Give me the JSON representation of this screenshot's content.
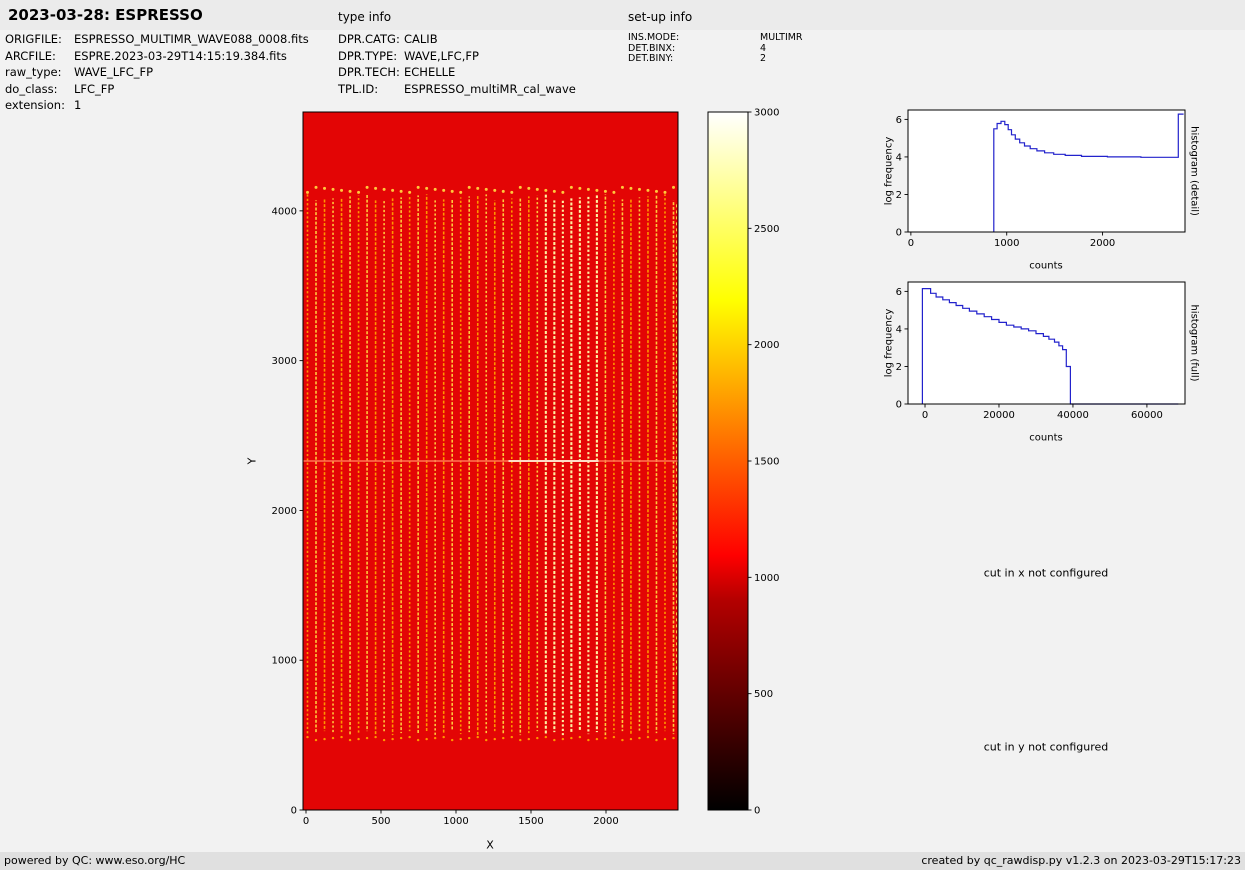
{
  "header": {
    "title": "2023-03-28: ESPRESSO",
    "type_info_label": "type info",
    "setup_info_label": "set-up info"
  },
  "file_info": {
    "rows": [
      {
        "label": "ORIGFILE:",
        "value": "ESPRESSO_MULTIMR_WAVE088_0008.fits"
      },
      {
        "label": "ARCFILE:",
        "value": "ESPRE.2023-03-29T14:15:19.384.fits"
      },
      {
        "label": "raw_type:",
        "value": "WAVE_LFC_FP"
      },
      {
        "label": "do_class:",
        "value": "LFC_FP"
      },
      {
        "label": "extension:",
        "value": "1"
      }
    ]
  },
  "type_info": {
    "rows": [
      {
        "label": "DPR.CATG:",
        "value": "CALIB"
      },
      {
        "label": "DPR.TYPE:",
        "value": "WAVE,LFC,FP"
      },
      {
        "label": "DPR.TECH:",
        "value": "ECHELLE"
      },
      {
        "label": "TPL.ID:",
        "value": "ESPRESSO_multiMR_cal_wave"
      }
    ]
  },
  "setup_info": {
    "rows": [
      {
        "label": "INS.MODE:",
        "value": "MULTIMR"
      },
      {
        "label": "DET.BINX:",
        "value": "4"
      },
      {
        "label": "DET.BINY:",
        "value": "2"
      }
    ]
  },
  "annotations": {
    "cut_x": "cut in x not configured",
    "cut_y": "cut in y not configured"
  },
  "footer": {
    "left": "powered by QC: www.eso.org/HC",
    "right": "created by qc_rawdisp.py v1.2.3 on 2023-03-29T15:17:23"
  },
  "chart_data": [
    {
      "id": "raw_frame",
      "type": "heatmap",
      "description": "ESPRESSO raw echelle calibration frame (WAVE,LFC,FP): dense vertical dashed LFC/FP emission stripes on uniform red background (~1000 counts), bad row near y=2330, brighter band near x=1550-1950, stripe region y=500-4110",
      "xlabel": "X",
      "ylabel": "Y",
      "xlim": [
        -20,
        2480
      ],
      "ylim": [
        0,
        4660
      ],
      "xticks": [
        0,
        500,
        1000,
        1500,
        2000
      ],
      "yticks": [
        0,
        1000,
        2000,
        3000,
        4000
      ],
      "colormap": "hot",
      "colormap_stops": [
        [
          0,
          "#000000"
        ],
        [
          0.1,
          "#3a0000"
        ],
        [
          0.2,
          "#760000"
        ],
        [
          0.3,
          "#b30000"
        ],
        [
          0.365,
          "#ff0000"
        ],
        [
          0.5,
          "#ff5e00"
        ],
        [
          0.6,
          "#ffa400"
        ],
        [
          0.73,
          "#ffff00"
        ],
        [
          0.85,
          "#ffff71"
        ],
        [
          1,
          "#ffffff"
        ]
      ],
      "colorbar": {
        "min": 0,
        "max": 3000,
        "ticks": [
          0,
          500,
          1000,
          1500,
          2000,
          2500,
          3000
        ]
      },
      "colors": {
        "background": "#e30505",
        "stripe_a": "#ffc83c",
        "stripe_b": "#ff9500",
        "stripe_bright": "#fff0a0",
        "bad_row": "#ff7755",
        "bad_row_bright": "#ffddc8"
      },
      "features": {
        "stripe_count": 44,
        "stripe_region_y": [
          500,
          4110
        ],
        "bad_row_y": 2330,
        "bright_band_x": [
          1550,
          1950
        ]
      }
    },
    {
      "id": "histogram_detail",
      "type": "line",
      "title": "histogram (detail)",
      "xlabel": "counts",
      "ylabel": "log frequency",
      "xlim": [
        -30,
        2860
      ],
      "ylim": [
        0,
        6.5
      ],
      "xticks": [
        0,
        1000,
        2000
      ],
      "yticks": [
        0,
        2,
        4,
        6
      ],
      "line_color": "#2222cc",
      "points": [
        [
          865,
          0
        ],
        [
          865,
          5.5
        ],
        [
          900,
          5.5
        ],
        [
          900,
          5.78
        ],
        [
          940,
          5.78
        ],
        [
          940,
          5.9
        ],
        [
          980,
          5.9
        ],
        [
          980,
          5.72
        ],
        [
          1015,
          5.72
        ],
        [
          1015,
          5.45
        ],
        [
          1050,
          5.45
        ],
        [
          1050,
          5.18
        ],
        [
          1090,
          5.18
        ],
        [
          1090,
          4.95
        ],
        [
          1135,
          4.95
        ],
        [
          1135,
          4.75
        ],
        [
          1185,
          4.75
        ],
        [
          1185,
          4.58
        ],
        [
          1245,
          4.58
        ],
        [
          1245,
          4.44
        ],
        [
          1315,
          4.44
        ],
        [
          1315,
          4.32
        ],
        [
          1395,
          4.32
        ],
        [
          1395,
          4.22
        ],
        [
          1490,
          4.22
        ],
        [
          1490,
          4.14
        ],
        [
          1610,
          4.14
        ],
        [
          1610,
          4.08
        ],
        [
          1780,
          4.08
        ],
        [
          1780,
          4.03
        ],
        [
          2050,
          4.03
        ],
        [
          2050,
          4.0
        ],
        [
          2400,
          4.0
        ],
        [
          2400,
          3.98
        ],
        [
          2790,
          3.98
        ],
        [
          2790,
          6.28
        ],
        [
          2845,
          6.28
        ]
      ]
    },
    {
      "id": "histogram_full",
      "type": "line",
      "title": "histogram (full)",
      "xlabel": "counts",
      "ylabel": "log frequency",
      "xlim": [
        -4600,
        70300
      ],
      "ylim": [
        0,
        6.5
      ],
      "xticks": [
        0,
        20000,
        40000,
        60000
      ],
      "yticks": [
        0,
        2,
        4,
        6
      ],
      "line_color": "#2222cc",
      "points": [
        [
          -700,
          0
        ],
        [
          -700,
          6.15
        ],
        [
          1500,
          6.15
        ],
        [
          1500,
          5.9
        ],
        [
          3000,
          5.9
        ],
        [
          3000,
          5.7
        ],
        [
          4800,
          5.7
        ],
        [
          4800,
          5.55
        ],
        [
          6600,
          5.55
        ],
        [
          6600,
          5.4
        ],
        [
          8400,
          5.4
        ],
        [
          8400,
          5.25
        ],
        [
          10200,
          5.25
        ],
        [
          10200,
          5.1
        ],
        [
          12000,
          5.1
        ],
        [
          12000,
          4.95
        ],
        [
          14000,
          4.95
        ],
        [
          14000,
          4.8
        ],
        [
          16000,
          4.8
        ],
        [
          16000,
          4.65
        ],
        [
          18000,
          4.65
        ],
        [
          18000,
          4.5
        ],
        [
          20000,
          4.5
        ],
        [
          20000,
          4.35
        ],
        [
          22000,
          4.35
        ],
        [
          22000,
          4.2
        ],
        [
          24000,
          4.2
        ],
        [
          24000,
          4.1
        ],
        [
          26000,
          4.1
        ],
        [
          26000,
          4.0
        ],
        [
          28000,
          4.0
        ],
        [
          28000,
          3.9
        ],
        [
          30000,
          3.9
        ],
        [
          30000,
          3.75
        ],
        [
          32000,
          3.75
        ],
        [
          32000,
          3.6
        ],
        [
          33500,
          3.6
        ],
        [
          33500,
          3.45
        ],
        [
          35000,
          3.45
        ],
        [
          35000,
          3.3
        ],
        [
          36200,
          3.3
        ],
        [
          36200,
          3.1
        ],
        [
          37200,
          3.1
        ],
        [
          37200,
          2.9
        ],
        [
          38200,
          2.9
        ],
        [
          38200,
          2.0
        ],
        [
          39300,
          2.0
        ],
        [
          39300,
          0
        ],
        [
          68500,
          0
        ]
      ]
    }
  ]
}
